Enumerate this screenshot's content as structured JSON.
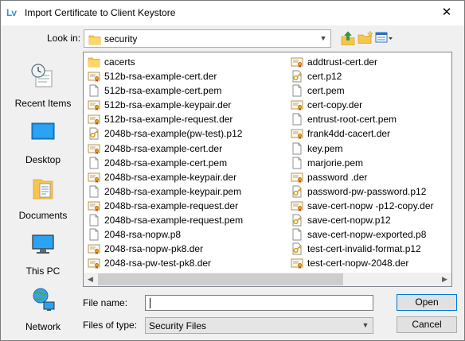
{
  "dialog": {
    "app_icon_text": "Lv",
    "title": "Import Certificate to Client Keystore",
    "close_glyph": "✕"
  },
  "look_in": {
    "label": "Look in:",
    "value": "security"
  },
  "places": [
    {
      "label": "Recent Items",
      "icon": "recent-items-icon"
    },
    {
      "label": "Desktop",
      "icon": "desktop-icon"
    },
    {
      "label": "Documents",
      "icon": "documents-icon"
    },
    {
      "label": "This PC",
      "icon": "this-pc-icon"
    },
    {
      "label": "Network",
      "icon": "network-icon"
    }
  ],
  "files": {
    "left": [
      {
        "name": "cacerts",
        "type": "folder"
      },
      {
        "name": "512b-rsa-example-cert.der",
        "type": "cert"
      },
      {
        "name": "512b-rsa-example-cert.pem",
        "type": "doc"
      },
      {
        "name": "512b-rsa-example-keypair.der",
        "type": "cert"
      },
      {
        "name": "512b-rsa-example-request.der",
        "type": "cert"
      },
      {
        "name": "2048b-rsa-example(pw-test).p12",
        "type": "pfx"
      },
      {
        "name": "2048b-rsa-example-cert.der",
        "type": "cert"
      },
      {
        "name": "2048b-rsa-example-cert.pem",
        "type": "doc"
      },
      {
        "name": "2048b-rsa-example-keypair.der",
        "type": "cert"
      },
      {
        "name": "2048b-rsa-example-keypair.pem",
        "type": "doc"
      },
      {
        "name": "2048b-rsa-example-request.der",
        "type": "cert"
      },
      {
        "name": "2048b-rsa-example-request.pem",
        "type": "doc"
      },
      {
        "name": "2048-rsa-nopw.p8",
        "type": "doc"
      },
      {
        "name": "2048-rsa-nopw-pk8.der",
        "type": "cert"
      },
      {
        "name": "2048-rsa-pw-test-pk8.der",
        "type": "cert"
      }
    ],
    "right": [
      {
        "name": "addtrust-cert.der",
        "type": "cert"
      },
      {
        "name": "cert.p12",
        "type": "pfx"
      },
      {
        "name": "cert.pem",
        "type": "doc"
      },
      {
        "name": "cert-copy.der",
        "type": "cert"
      },
      {
        "name": "entrust-root-cert.pem",
        "type": "doc"
      },
      {
        "name": "frank4dd-cacert.der",
        "type": "cert"
      },
      {
        "name": "key.pem",
        "type": "doc"
      },
      {
        "name": "marjorie.pem",
        "type": "doc"
      },
      {
        "name": "password .der",
        "type": "cert"
      },
      {
        "name": "password-pw-password.p12",
        "type": "pfx"
      },
      {
        "name": "save-cert-nopw -p12-copy.der",
        "type": "cert"
      },
      {
        "name": "save-cert-nopw.p12",
        "type": "pfx"
      },
      {
        "name": "save-cert-nopw-exported.p8",
        "type": "doc"
      },
      {
        "name": "test-cert-invalid-format.p12",
        "type": "pfx"
      },
      {
        "name": "test-cert-nopw-2048.der",
        "type": "cert"
      }
    ]
  },
  "file_name": {
    "label": "File name:",
    "value": ""
  },
  "file_type": {
    "label": "Files of type:",
    "value": "Security Files"
  },
  "buttons": {
    "open": "Open",
    "cancel": "Cancel"
  },
  "scroll_arrows": {
    "left": "◀",
    "right": "▶",
    "down": "▼"
  },
  "colors": {
    "folder": "#f5c64d",
    "accent": "#0078d7",
    "window_bg": "#f0f0f0"
  }
}
